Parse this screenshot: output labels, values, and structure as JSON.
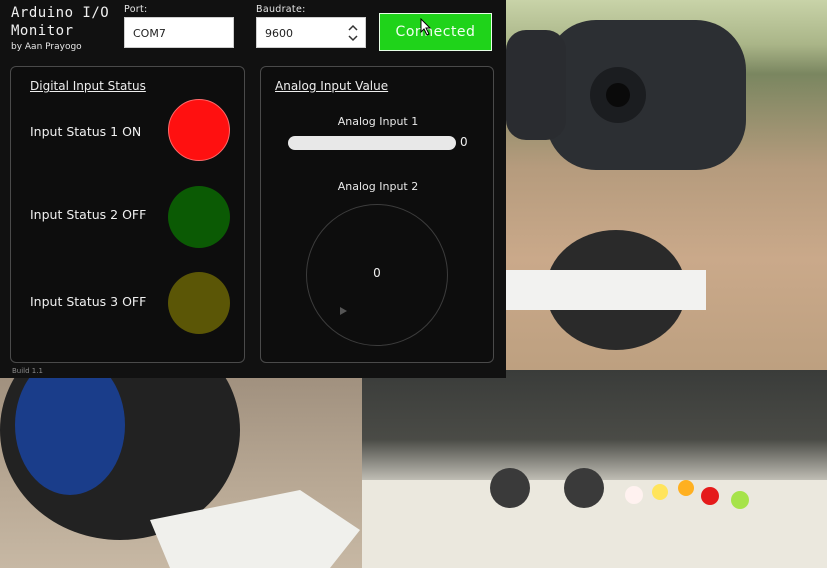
{
  "app": {
    "title": "Arduino I/O Monitor",
    "author": "by Aan Prayogo",
    "build": "Build 1.1"
  },
  "connection": {
    "port_label": "Port:",
    "port_value": "COM7",
    "baud_label": "Baudrate:",
    "baud_value": "9600",
    "connect_button": "Connected",
    "connect_color": "#1fd31a"
  },
  "digital": {
    "title": "Digital Input Status",
    "items": [
      {
        "label": "Input Status 1 ON",
        "state": "on",
        "color": "#ff1010"
      },
      {
        "label": "Input Status 2 OFF",
        "state": "off",
        "color": "#0b5a04"
      },
      {
        "label": "Input Status 3 OFF",
        "state": "off",
        "color": "#5b5606"
      }
    ]
  },
  "analog": {
    "title": "Analog Input Value",
    "input1_label": "Analog Input 1",
    "input1_value": "0",
    "input2_label": "Analog Input 2",
    "input2_value": "0"
  }
}
